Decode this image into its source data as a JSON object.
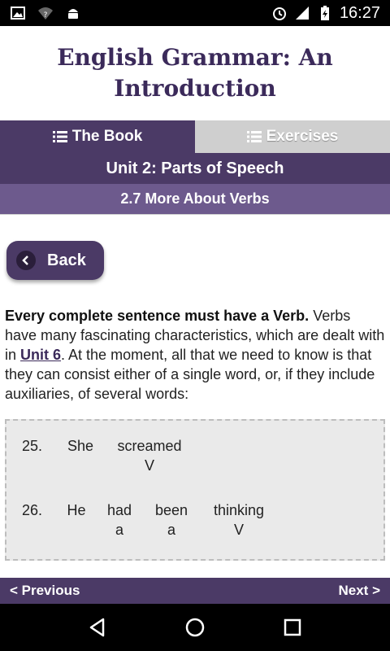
{
  "status_bar": {
    "time": "16:27",
    "icons": [
      "image-icon",
      "wifi-question-icon",
      "android-icon",
      "alarm-icon",
      "signal-icon",
      "battery-charging-icon"
    ]
  },
  "app_title": "English Grammar: An Introduction",
  "tabs": [
    {
      "label": "The Book",
      "icon": "list-icon",
      "active": true
    },
    {
      "label": "Exercises",
      "icon": "list-icon",
      "active": false
    }
  ],
  "unit_title": "Unit 2: Parts of Speech",
  "section_title": "2.7 More About Verbs",
  "back_button": {
    "label": "Back"
  },
  "paragraph": {
    "bold_lead": "Every complete sentence must have a Verb.",
    "text_before_link": " Verbs have many fascinating characteristics, which are dealt with in ",
    "link": "Unit 6",
    "text_after_link": ". At the moment, all that we need to know is that they can consist either of a single word, or, if they include auxiliaries, of several words:"
  },
  "examples": [
    {
      "number": "25.",
      "words": [
        {
          "word": "She",
          "tag": ""
        },
        {
          "word": "screamed",
          "tag": "V"
        }
      ]
    },
    {
      "number": "26.",
      "words": [
        {
          "word": "He",
          "tag": ""
        },
        {
          "word": "had",
          "tag": "a"
        },
        {
          "word": "been",
          "tag": "a"
        },
        {
          "word": "thinking",
          "tag": "V"
        }
      ]
    }
  ],
  "nav": {
    "previous": "< Previous",
    "next": "Next >"
  },
  "colors": {
    "primary": "#4b3a66",
    "secondary": "#6d5a8d",
    "title": "#3b2a5a",
    "tab_inactive": "#cfcfcf",
    "example_bg": "#eaeaea"
  }
}
